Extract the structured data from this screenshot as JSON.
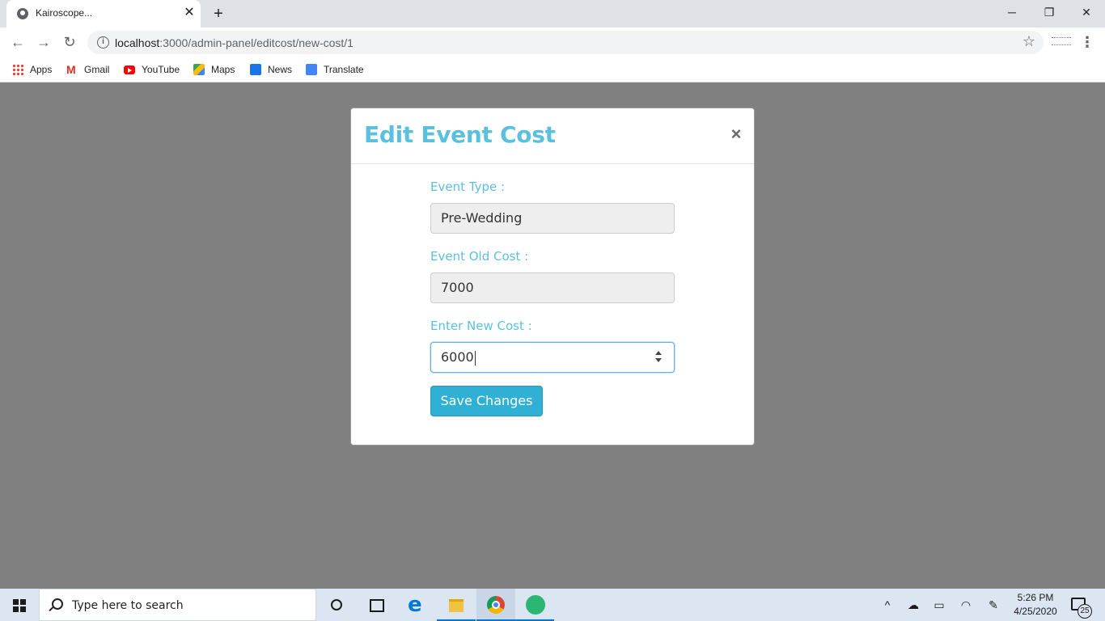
{
  "browser": {
    "tab_title": "Kairoscope...",
    "tab_close": "✕",
    "new_tab": "+",
    "window": {
      "minimize": "─",
      "restore": "❐",
      "close": "✕"
    },
    "nav": {
      "back": "←",
      "forward": "→",
      "reload": "↻"
    },
    "url_host": "localhost",
    "url_path": ":3000/admin-panel/editcost/new-cost/1",
    "star": "☆",
    "menu": "⋮",
    "bookmarks": [
      {
        "label": "Apps",
        "icon": "apps-grid-icon"
      },
      {
        "label": "Gmail",
        "icon": "gmail-icon"
      },
      {
        "label": "YouTube",
        "icon": "youtube-icon"
      },
      {
        "label": "Maps",
        "icon": "maps-icon"
      },
      {
        "label": "News",
        "icon": "news-icon"
      },
      {
        "label": "Translate",
        "icon": "translate-icon"
      }
    ]
  },
  "modal": {
    "title": "Edit Event Cost",
    "close": "×",
    "fields": [
      {
        "label": "Event Type :",
        "value": "Pre-Wedding",
        "readonly": true
      },
      {
        "label": "Event Old Cost :",
        "value": "7000",
        "readonly": true
      },
      {
        "label": "Enter New Cost :",
        "value": "6000",
        "readonly": false
      }
    ],
    "submit_label": "Save Changes",
    "accent_color": "#5bc0de",
    "button_color": "#31b0d5"
  },
  "taskbar": {
    "search_placeholder": "Type here to search",
    "time": "5:26 PM",
    "date": "4/25/2020",
    "notification_count": "25",
    "tray": {
      "chevron": "^"
    }
  }
}
